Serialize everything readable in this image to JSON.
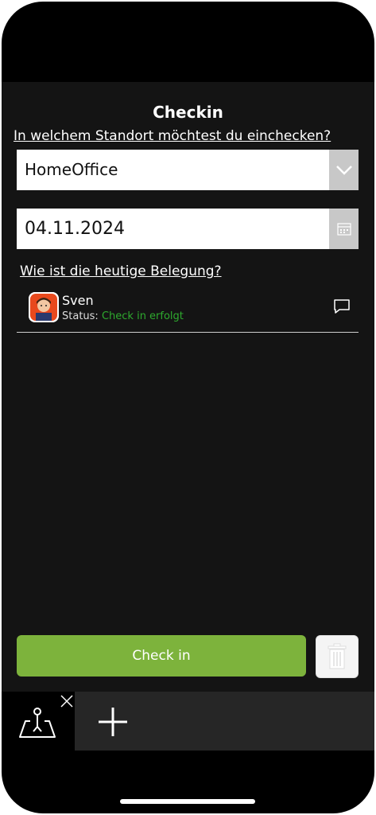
{
  "header": {
    "title": "Checkin"
  },
  "location": {
    "question": "In welchem Standort möchtest du einchecken?",
    "selected": "HomeOffice",
    "dropdown_icon": "chevron-down-icon"
  },
  "date": {
    "value": "04.11.2024",
    "icon": "calendar-icon"
  },
  "occupancy": {
    "question": "Wie ist die heutige Belegung?",
    "people": [
      {
        "name": "Sven",
        "status_label": "Status:",
        "status_value": "Check in erfolgt",
        "status_color": "#2eaa2e",
        "icon": "chat-icon"
      }
    ]
  },
  "actions": {
    "checkin_label": "Check in",
    "checkin_color": "#7db33c",
    "delete_icon": "trash-icon"
  },
  "tabbar": {
    "tabs": [
      {
        "icon": "map-location-icon",
        "close_icon": "close-icon"
      }
    ],
    "add_icon": "plus-icon"
  }
}
